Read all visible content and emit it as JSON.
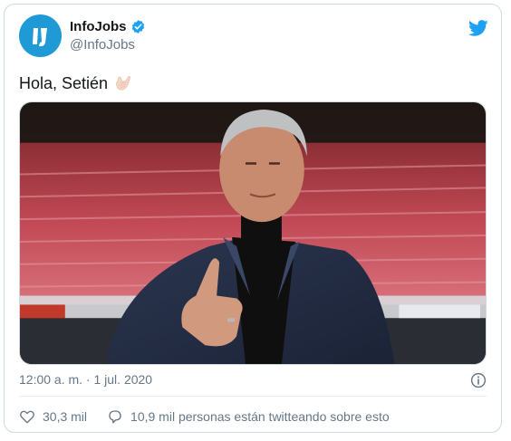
{
  "account": {
    "display_name": "InfoJobs",
    "handle": "@InfoJobs",
    "avatar_text": "IJ"
  },
  "tweet": {
    "text": "Hola, Setién",
    "emoji": "call-me-hand-emoji",
    "timestamp": "12:00 a. m. · 1 jul. 2020"
  },
  "actions": {
    "likes": "30,3 mil",
    "conversation": "10,9 mil personas están twitteando sobre esto"
  },
  "colors": {
    "brand": "#1da1f2",
    "avatar": "#1f9ad6",
    "muted": "#657786",
    "border": "#cfd9de"
  },
  "icons": [
    "verified-icon",
    "twitter-bird-icon",
    "info-icon",
    "heart-icon",
    "speech-bubble-icon"
  ]
}
